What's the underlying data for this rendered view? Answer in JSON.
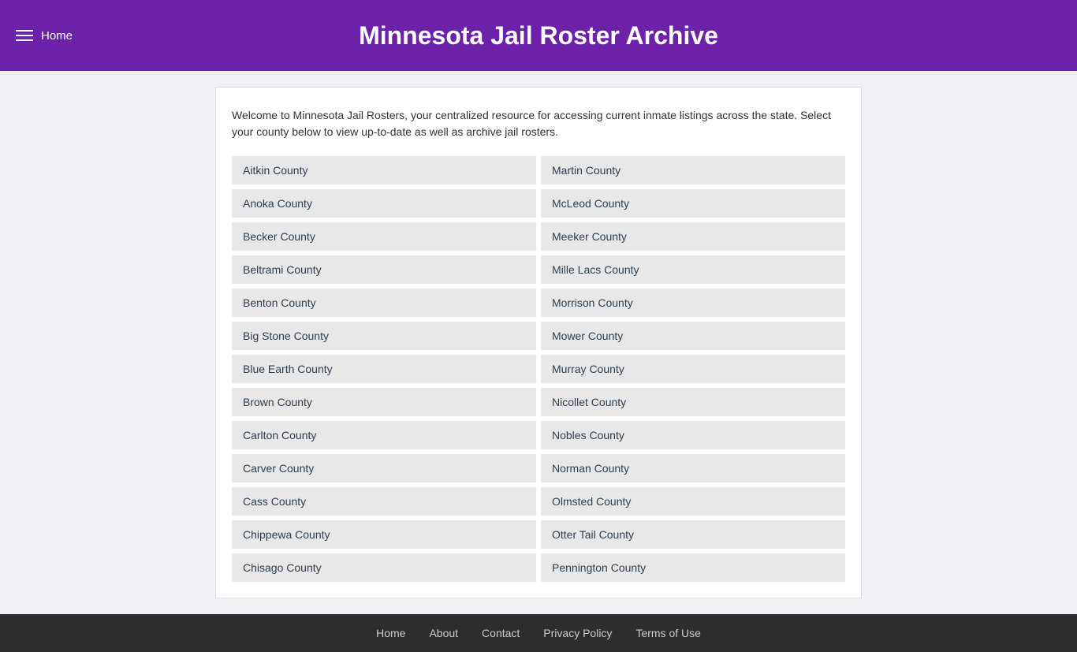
{
  "header": {
    "title": "Minnesota Jail Roster Archive",
    "nav_toggle_label": "Menu",
    "home_label": "Home"
  },
  "intro": {
    "text": "Welcome to Minnesota Jail Rosters, your centralized resource for accessing current inmate listings across the state. Select your county below to view up-to-date as well as archive jail rosters."
  },
  "counties_left": [
    "Aitkin County",
    "Anoka County",
    "Becker County",
    "Beltrami County",
    "Benton County",
    "Big Stone County",
    "Blue Earth County",
    "Brown County",
    "Carlton County",
    "Carver County",
    "Cass County",
    "Chippewa County",
    "Chisago County"
  ],
  "counties_right": [
    "Martin County",
    "McLeod County",
    "Meeker County",
    "Mille Lacs County",
    "Morrison County",
    "Mower County",
    "Murray County",
    "Nicollet County",
    "Nobles County",
    "Norman County",
    "Olmsted County",
    "Otter Tail County",
    "Pennington County"
  ],
  "footer": {
    "links": [
      "Home",
      "About",
      "Contact",
      "Privacy Policy",
      "Terms of Use"
    ]
  }
}
